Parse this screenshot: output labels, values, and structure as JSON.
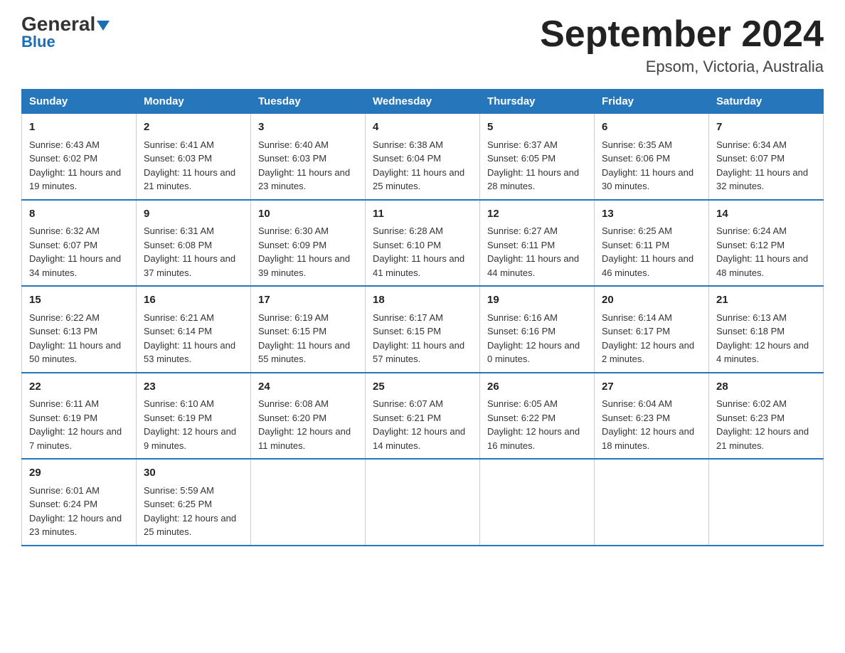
{
  "header": {
    "logo_general": "General",
    "logo_blue": "Blue",
    "month_title": "September 2024",
    "location": "Epsom, Victoria, Australia"
  },
  "weekdays": [
    "Sunday",
    "Monday",
    "Tuesday",
    "Wednesday",
    "Thursday",
    "Friday",
    "Saturday"
  ],
  "weeks": [
    [
      {
        "day": "1",
        "sunrise": "6:43 AM",
        "sunset": "6:02 PM",
        "daylight": "11 hours and 19 minutes."
      },
      {
        "day": "2",
        "sunrise": "6:41 AM",
        "sunset": "6:03 PM",
        "daylight": "11 hours and 21 minutes."
      },
      {
        "day": "3",
        "sunrise": "6:40 AM",
        "sunset": "6:03 PM",
        "daylight": "11 hours and 23 minutes."
      },
      {
        "day": "4",
        "sunrise": "6:38 AM",
        "sunset": "6:04 PM",
        "daylight": "11 hours and 25 minutes."
      },
      {
        "day": "5",
        "sunrise": "6:37 AM",
        "sunset": "6:05 PM",
        "daylight": "11 hours and 28 minutes."
      },
      {
        "day": "6",
        "sunrise": "6:35 AM",
        "sunset": "6:06 PM",
        "daylight": "11 hours and 30 minutes."
      },
      {
        "day": "7",
        "sunrise": "6:34 AM",
        "sunset": "6:07 PM",
        "daylight": "11 hours and 32 minutes."
      }
    ],
    [
      {
        "day": "8",
        "sunrise": "6:32 AM",
        "sunset": "6:07 PM",
        "daylight": "11 hours and 34 minutes."
      },
      {
        "day": "9",
        "sunrise": "6:31 AM",
        "sunset": "6:08 PM",
        "daylight": "11 hours and 37 minutes."
      },
      {
        "day": "10",
        "sunrise": "6:30 AM",
        "sunset": "6:09 PM",
        "daylight": "11 hours and 39 minutes."
      },
      {
        "day": "11",
        "sunrise": "6:28 AM",
        "sunset": "6:10 PM",
        "daylight": "11 hours and 41 minutes."
      },
      {
        "day": "12",
        "sunrise": "6:27 AM",
        "sunset": "6:11 PM",
        "daylight": "11 hours and 44 minutes."
      },
      {
        "day": "13",
        "sunrise": "6:25 AM",
        "sunset": "6:11 PM",
        "daylight": "11 hours and 46 minutes."
      },
      {
        "day": "14",
        "sunrise": "6:24 AM",
        "sunset": "6:12 PM",
        "daylight": "11 hours and 48 minutes."
      }
    ],
    [
      {
        "day": "15",
        "sunrise": "6:22 AM",
        "sunset": "6:13 PM",
        "daylight": "11 hours and 50 minutes."
      },
      {
        "day": "16",
        "sunrise": "6:21 AM",
        "sunset": "6:14 PM",
        "daylight": "11 hours and 53 minutes."
      },
      {
        "day": "17",
        "sunrise": "6:19 AM",
        "sunset": "6:15 PM",
        "daylight": "11 hours and 55 minutes."
      },
      {
        "day": "18",
        "sunrise": "6:17 AM",
        "sunset": "6:15 PM",
        "daylight": "11 hours and 57 minutes."
      },
      {
        "day": "19",
        "sunrise": "6:16 AM",
        "sunset": "6:16 PM",
        "daylight": "12 hours and 0 minutes."
      },
      {
        "day": "20",
        "sunrise": "6:14 AM",
        "sunset": "6:17 PM",
        "daylight": "12 hours and 2 minutes."
      },
      {
        "day": "21",
        "sunrise": "6:13 AM",
        "sunset": "6:18 PM",
        "daylight": "12 hours and 4 minutes."
      }
    ],
    [
      {
        "day": "22",
        "sunrise": "6:11 AM",
        "sunset": "6:19 PM",
        "daylight": "12 hours and 7 minutes."
      },
      {
        "day": "23",
        "sunrise": "6:10 AM",
        "sunset": "6:19 PM",
        "daylight": "12 hours and 9 minutes."
      },
      {
        "day": "24",
        "sunrise": "6:08 AM",
        "sunset": "6:20 PM",
        "daylight": "12 hours and 11 minutes."
      },
      {
        "day": "25",
        "sunrise": "6:07 AM",
        "sunset": "6:21 PM",
        "daylight": "12 hours and 14 minutes."
      },
      {
        "day": "26",
        "sunrise": "6:05 AM",
        "sunset": "6:22 PM",
        "daylight": "12 hours and 16 minutes."
      },
      {
        "day": "27",
        "sunrise": "6:04 AM",
        "sunset": "6:23 PM",
        "daylight": "12 hours and 18 minutes."
      },
      {
        "day": "28",
        "sunrise": "6:02 AM",
        "sunset": "6:23 PM",
        "daylight": "12 hours and 21 minutes."
      }
    ],
    [
      {
        "day": "29",
        "sunrise": "6:01 AM",
        "sunset": "6:24 PM",
        "daylight": "12 hours and 23 minutes."
      },
      {
        "day": "30",
        "sunrise": "5:59 AM",
        "sunset": "6:25 PM",
        "daylight": "12 hours and 25 minutes."
      },
      null,
      null,
      null,
      null,
      null
    ]
  ],
  "labels": {
    "sunrise": "Sunrise:",
    "sunset": "Sunset:",
    "daylight": "Daylight:"
  }
}
